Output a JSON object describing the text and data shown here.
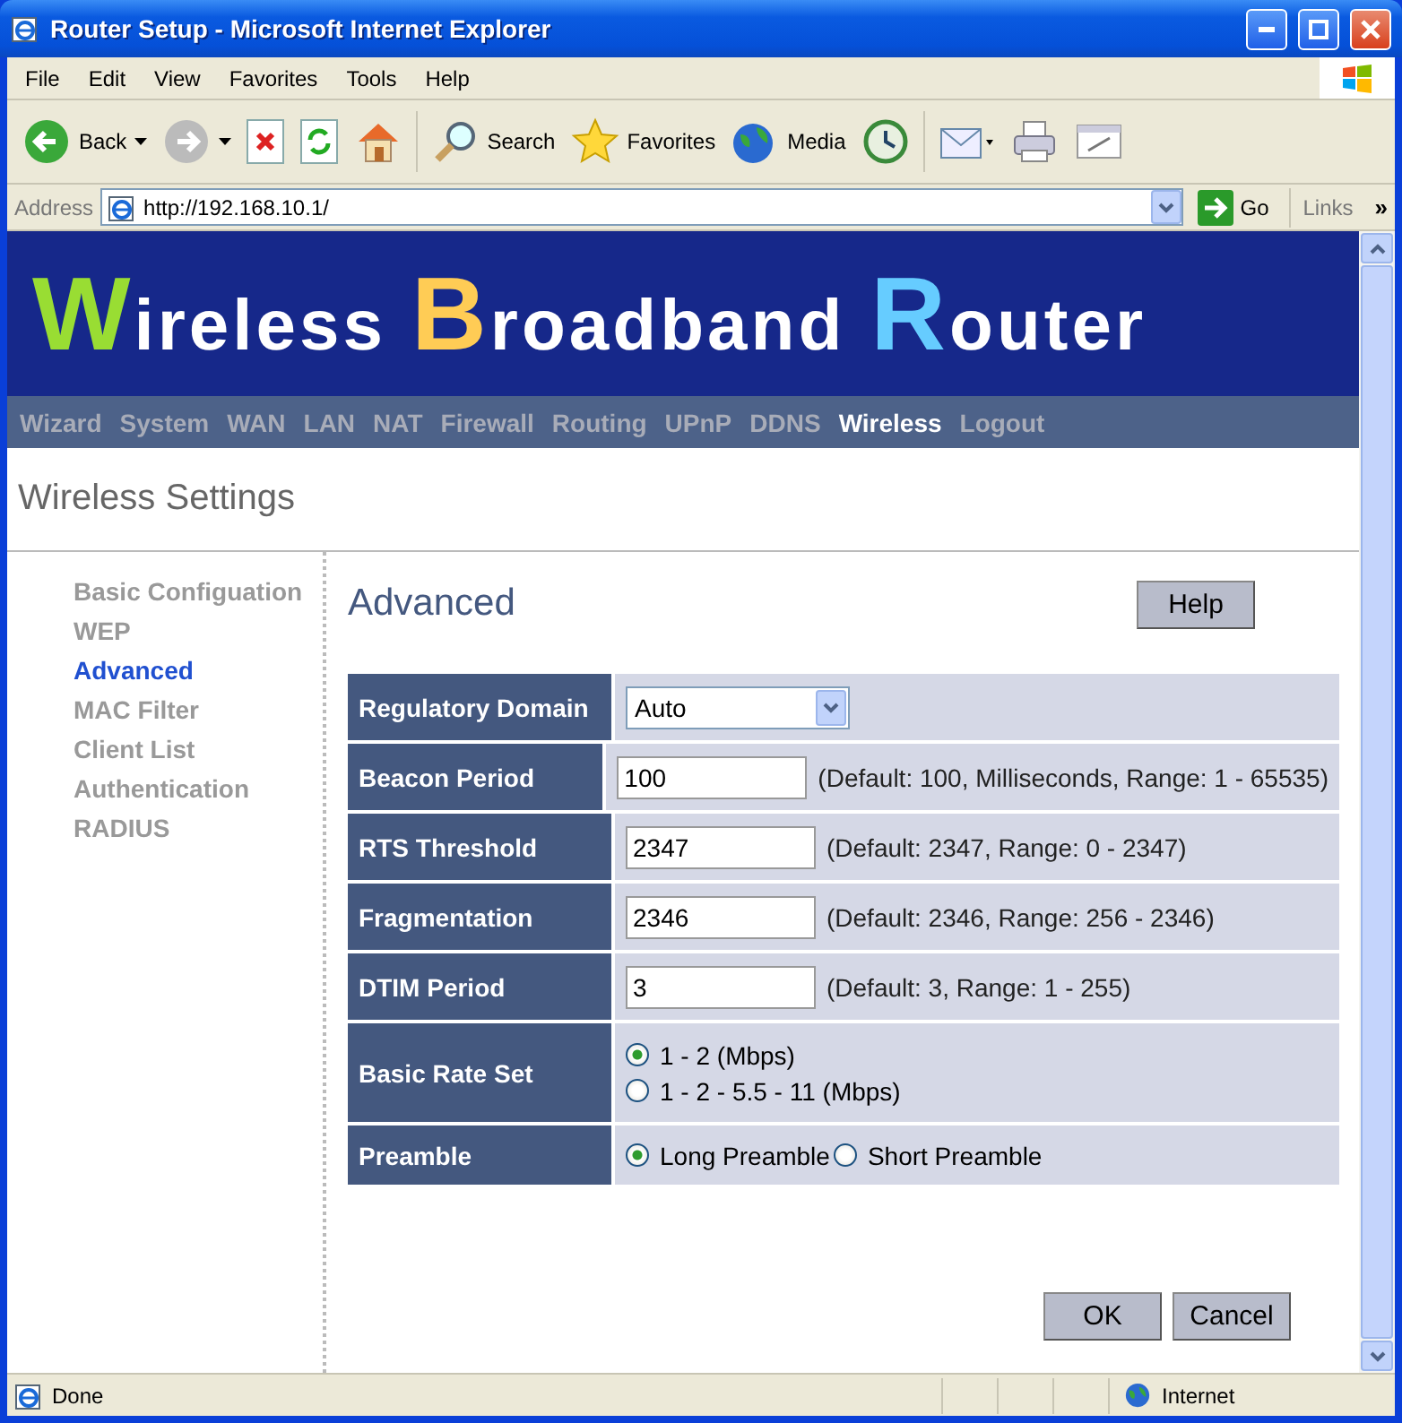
{
  "window": {
    "title": "Router Setup - Microsoft Internet Explorer"
  },
  "menu": [
    "File",
    "Edit",
    "View",
    "Favorites",
    "Tools",
    "Help"
  ],
  "toolbar": [
    {
      "kind": "back",
      "label": "Back"
    },
    {
      "kind": "forward"
    },
    {
      "kind": "stop"
    },
    {
      "kind": "refresh"
    },
    {
      "kind": "home"
    },
    {
      "kind": "search",
      "label": "Search"
    },
    {
      "kind": "favorites",
      "label": "Favorites"
    },
    {
      "kind": "media",
      "label": "Media"
    },
    {
      "kind": "history"
    },
    {
      "kind": "mail"
    },
    {
      "kind": "print"
    },
    {
      "kind": "edit"
    }
  ],
  "address": {
    "label": "Address",
    "url": "http://192.168.10.1/",
    "go": "Go",
    "links": "Links",
    "more": "»"
  },
  "banner": [
    {
      "initial": "W",
      "rest": "ireless",
      "color": "#99dd33"
    },
    {
      "initial": "B",
      "rest": "roadband",
      "color": "#ffcc55"
    },
    {
      "initial": "R",
      "rest": "outer",
      "color": "#66ccff"
    }
  ],
  "nav": [
    {
      "label": "Wizard",
      "selected": false
    },
    {
      "label": "System",
      "selected": false
    },
    {
      "label": "WAN",
      "selected": false
    },
    {
      "label": "LAN",
      "selected": false
    },
    {
      "label": "NAT",
      "selected": false
    },
    {
      "label": "Firewall",
      "selected": false
    },
    {
      "label": "Routing",
      "selected": false
    },
    {
      "label": "UPnP",
      "selected": false
    },
    {
      "label": "DDNS",
      "selected": false
    },
    {
      "label": "Wireless",
      "selected": true
    },
    {
      "label": "Logout",
      "selected": false
    }
  ],
  "page_title": "Wireless Settings",
  "sidebar": [
    {
      "label": "Basic Configuation",
      "selected": false
    },
    {
      "label": "WEP",
      "selected": false
    },
    {
      "label": "Advanced",
      "selected": true
    },
    {
      "label": "MAC Filter",
      "selected": false
    },
    {
      "label": "Client List",
      "selected": false
    },
    {
      "label": "Authentication",
      "selected": false
    },
    {
      "label": "RADIUS",
      "selected": false
    }
  ],
  "section_title": "Advanced",
  "help_button": "Help",
  "settings": [
    {
      "kind": "select",
      "label": "Regulatory Domain",
      "value": "Auto"
    },
    {
      "kind": "text",
      "label": "Beacon Period",
      "value": "100",
      "hint": "(Default: 100, Milliseconds, Range: 1 - 65535)"
    },
    {
      "kind": "text",
      "label": "RTS Threshold",
      "value": "2347",
      "hint": "(Default: 2347, Range: 0 - 2347)"
    },
    {
      "kind": "text",
      "label": "Fragmentation",
      "value": "2346",
      "hint": "(Default: 2346, Range: 256 - 2346)"
    },
    {
      "kind": "text",
      "label": "DTIM Period",
      "value": "3",
      "hint": "(Default: 3, Range: 1 - 255)"
    },
    {
      "kind": "radio_stack",
      "label": "Basic Rate Set",
      "options": [
        {
          "label": "1 - 2 (Mbps)",
          "selected": true
        },
        {
          "label": "1 - 2 - 5.5 - 11 (Mbps)",
          "selected": false
        }
      ]
    },
    {
      "kind": "radio_inline",
      "label": "Preamble",
      "options": [
        {
          "label": "Long Preamble",
          "selected": true
        },
        {
          "label": "Short Preamble",
          "selected": false
        }
      ]
    }
  ],
  "buttons": [
    "OK",
    "Cancel"
  ],
  "status_bar": {
    "text": "Done",
    "zone": "Internet"
  }
}
